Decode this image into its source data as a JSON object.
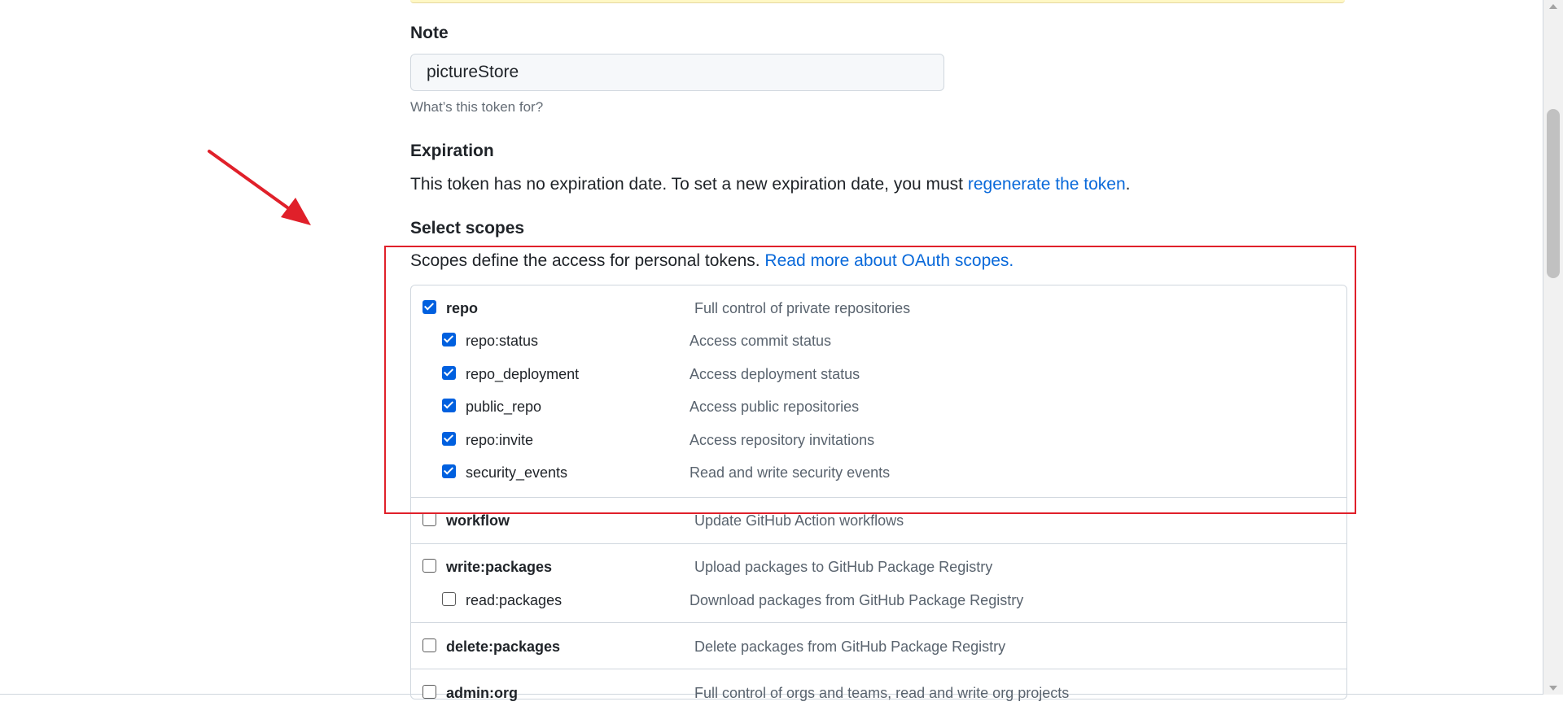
{
  "note": {
    "label": "Note",
    "value": "pictureStore",
    "hint": "What’s this token for?"
  },
  "expiration": {
    "label": "Expiration",
    "text_before": "This token has no expiration date. To set a new expiration date, you must ",
    "link": "regenerate the token",
    "text_after": "."
  },
  "scopes": {
    "label": "Select scopes",
    "intro": "Scopes define the access for personal tokens. ",
    "intro_link": "Read more about OAuth scopes.",
    "items": [
      {
        "name": "repo",
        "desc": "Full control of private repositories",
        "checked": true,
        "parent": true
      },
      {
        "name": "repo:status",
        "desc": "Access commit status",
        "checked": true,
        "parent": false
      },
      {
        "name": "repo_deployment",
        "desc": "Access deployment status",
        "checked": true,
        "parent": false
      },
      {
        "name": "public_repo",
        "desc": "Access public repositories",
        "checked": true,
        "parent": false
      },
      {
        "name": "repo:invite",
        "desc": "Access repository invitations",
        "checked": true,
        "parent": false
      },
      {
        "name": "security_events",
        "desc": "Read and write security events",
        "checked": true,
        "parent": false
      },
      {
        "name": "workflow",
        "desc": "Update GitHub Action workflows",
        "checked": false,
        "parent": true
      },
      {
        "name": "write:packages",
        "desc": "Upload packages to GitHub Package Registry",
        "checked": false,
        "parent": true
      },
      {
        "name": "read:packages",
        "desc": "Download packages from GitHub Package Registry",
        "checked": false,
        "parent": false
      },
      {
        "name": "delete:packages",
        "desc": "Delete packages from GitHub Package Registry",
        "checked": false,
        "parent": true
      },
      {
        "name": "admin:org",
        "desc": "Full control of orgs and teams, read and write org projects",
        "checked": false,
        "parent": true
      }
    ]
  },
  "annotation_colors": {
    "arrow": "#e0202a",
    "highlight_box": "#e0202a"
  }
}
